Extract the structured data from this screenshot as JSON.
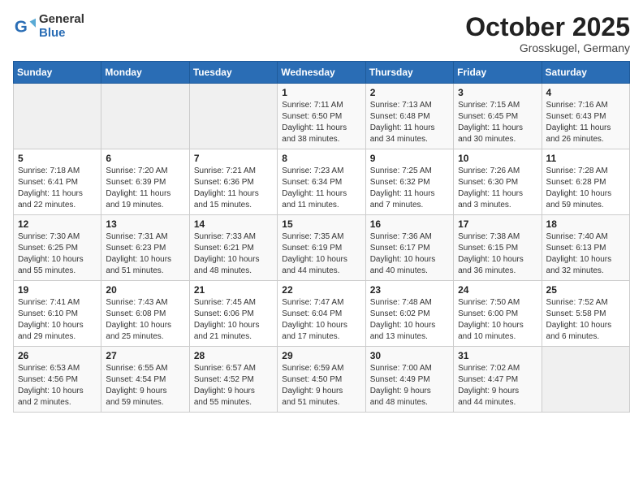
{
  "logo": {
    "general": "General",
    "blue": "Blue"
  },
  "title": "October 2025",
  "subtitle": "Grosskugel, Germany",
  "weekdays": [
    "Sunday",
    "Monday",
    "Tuesday",
    "Wednesday",
    "Thursday",
    "Friday",
    "Saturday"
  ],
  "weeks": [
    [
      {
        "num": "",
        "info": ""
      },
      {
        "num": "",
        "info": ""
      },
      {
        "num": "",
        "info": ""
      },
      {
        "num": "1",
        "info": "Sunrise: 7:11 AM\nSunset: 6:50 PM\nDaylight: 11 hours\nand 38 minutes."
      },
      {
        "num": "2",
        "info": "Sunrise: 7:13 AM\nSunset: 6:48 PM\nDaylight: 11 hours\nand 34 minutes."
      },
      {
        "num": "3",
        "info": "Sunrise: 7:15 AM\nSunset: 6:45 PM\nDaylight: 11 hours\nand 30 minutes."
      },
      {
        "num": "4",
        "info": "Sunrise: 7:16 AM\nSunset: 6:43 PM\nDaylight: 11 hours\nand 26 minutes."
      }
    ],
    [
      {
        "num": "5",
        "info": "Sunrise: 7:18 AM\nSunset: 6:41 PM\nDaylight: 11 hours\nand 22 minutes."
      },
      {
        "num": "6",
        "info": "Sunrise: 7:20 AM\nSunset: 6:39 PM\nDaylight: 11 hours\nand 19 minutes."
      },
      {
        "num": "7",
        "info": "Sunrise: 7:21 AM\nSunset: 6:36 PM\nDaylight: 11 hours\nand 15 minutes."
      },
      {
        "num": "8",
        "info": "Sunrise: 7:23 AM\nSunset: 6:34 PM\nDaylight: 11 hours\nand 11 minutes."
      },
      {
        "num": "9",
        "info": "Sunrise: 7:25 AM\nSunset: 6:32 PM\nDaylight: 11 hours\nand 7 minutes."
      },
      {
        "num": "10",
        "info": "Sunrise: 7:26 AM\nSunset: 6:30 PM\nDaylight: 11 hours\nand 3 minutes."
      },
      {
        "num": "11",
        "info": "Sunrise: 7:28 AM\nSunset: 6:28 PM\nDaylight: 10 hours\nand 59 minutes."
      }
    ],
    [
      {
        "num": "12",
        "info": "Sunrise: 7:30 AM\nSunset: 6:25 PM\nDaylight: 10 hours\nand 55 minutes."
      },
      {
        "num": "13",
        "info": "Sunrise: 7:31 AM\nSunset: 6:23 PM\nDaylight: 10 hours\nand 51 minutes."
      },
      {
        "num": "14",
        "info": "Sunrise: 7:33 AM\nSunset: 6:21 PM\nDaylight: 10 hours\nand 48 minutes."
      },
      {
        "num": "15",
        "info": "Sunrise: 7:35 AM\nSunset: 6:19 PM\nDaylight: 10 hours\nand 44 minutes."
      },
      {
        "num": "16",
        "info": "Sunrise: 7:36 AM\nSunset: 6:17 PM\nDaylight: 10 hours\nand 40 minutes."
      },
      {
        "num": "17",
        "info": "Sunrise: 7:38 AM\nSunset: 6:15 PM\nDaylight: 10 hours\nand 36 minutes."
      },
      {
        "num": "18",
        "info": "Sunrise: 7:40 AM\nSunset: 6:13 PM\nDaylight: 10 hours\nand 32 minutes."
      }
    ],
    [
      {
        "num": "19",
        "info": "Sunrise: 7:41 AM\nSunset: 6:10 PM\nDaylight: 10 hours\nand 29 minutes."
      },
      {
        "num": "20",
        "info": "Sunrise: 7:43 AM\nSunset: 6:08 PM\nDaylight: 10 hours\nand 25 minutes."
      },
      {
        "num": "21",
        "info": "Sunrise: 7:45 AM\nSunset: 6:06 PM\nDaylight: 10 hours\nand 21 minutes."
      },
      {
        "num": "22",
        "info": "Sunrise: 7:47 AM\nSunset: 6:04 PM\nDaylight: 10 hours\nand 17 minutes."
      },
      {
        "num": "23",
        "info": "Sunrise: 7:48 AM\nSunset: 6:02 PM\nDaylight: 10 hours\nand 13 minutes."
      },
      {
        "num": "24",
        "info": "Sunrise: 7:50 AM\nSunset: 6:00 PM\nDaylight: 10 hours\nand 10 minutes."
      },
      {
        "num": "25",
        "info": "Sunrise: 7:52 AM\nSunset: 5:58 PM\nDaylight: 10 hours\nand 6 minutes."
      }
    ],
    [
      {
        "num": "26",
        "info": "Sunrise: 6:53 AM\nSunset: 4:56 PM\nDaylight: 10 hours\nand 2 minutes."
      },
      {
        "num": "27",
        "info": "Sunrise: 6:55 AM\nSunset: 4:54 PM\nDaylight: 9 hours\nand 59 minutes."
      },
      {
        "num": "28",
        "info": "Sunrise: 6:57 AM\nSunset: 4:52 PM\nDaylight: 9 hours\nand 55 minutes."
      },
      {
        "num": "29",
        "info": "Sunrise: 6:59 AM\nSunset: 4:50 PM\nDaylight: 9 hours\nand 51 minutes."
      },
      {
        "num": "30",
        "info": "Sunrise: 7:00 AM\nSunset: 4:49 PM\nDaylight: 9 hours\nand 48 minutes."
      },
      {
        "num": "31",
        "info": "Sunrise: 7:02 AM\nSunset: 4:47 PM\nDaylight: 9 hours\nand 44 minutes."
      },
      {
        "num": "",
        "info": ""
      }
    ]
  ]
}
